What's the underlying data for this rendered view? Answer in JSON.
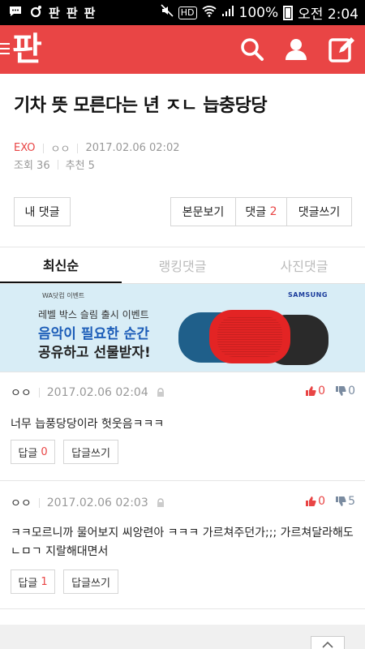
{
  "status_bar": {
    "pan_labels": [
      "판",
      "판",
      "판"
    ],
    "hd": "HD",
    "battery": "100%",
    "time": "오전 2:04"
  },
  "app": {
    "logo": "판",
    "accent": "#e94545"
  },
  "post": {
    "title": "기차 뜻 모른다는 년 ㅈㄴ 늡충당당",
    "category": "EXO",
    "author": "ㅇㅇ",
    "date": "2017.02.06 02:02",
    "views_label": "조회 36",
    "recommend_label": "추천 5"
  },
  "actions": {
    "my_comments": "내 댓글",
    "view_post": "본문보기",
    "comments_label": "댓글",
    "comments_count": "2",
    "write_comment": "댓글쓰기"
  },
  "tabs": [
    {
      "label": "최신순",
      "active": true
    },
    {
      "label": "랭킹댓글",
      "active": false
    },
    {
      "label": "사진댓글",
      "active": false
    }
  ],
  "banner": {
    "small": "WA닷컴 이벤트",
    "brand": "SAMSUNG",
    "line1": "레벨 박스 슬림 출시 이벤트",
    "line2": "음악이 필요한 순간",
    "line3": "공유하고 선물받자!"
  },
  "comments": [
    {
      "author": "ㅇㅇ",
      "date": "2017.02.06 02:04",
      "up": "0",
      "down": "0",
      "body": "너무 늡풍당당이라 헛웃음ㅋㅋㅋ",
      "reply_label": "답글",
      "reply_count": "0",
      "write_label": "답글쓰기"
    },
    {
      "author": "ㅇㅇ",
      "date": "2017.02.06 02:03",
      "up": "0",
      "down": "5",
      "body": "ㅋㅋ모르니까 물어보지 씨앙련아 ㅋㅋㅋ 가르쳐주던가;;; 가르쳐달라해도 ㄴㅁㄱ 지랄해대면서",
      "reply_label": "답글",
      "reply_count": "1",
      "write_label": "답글쓰기"
    }
  ]
}
